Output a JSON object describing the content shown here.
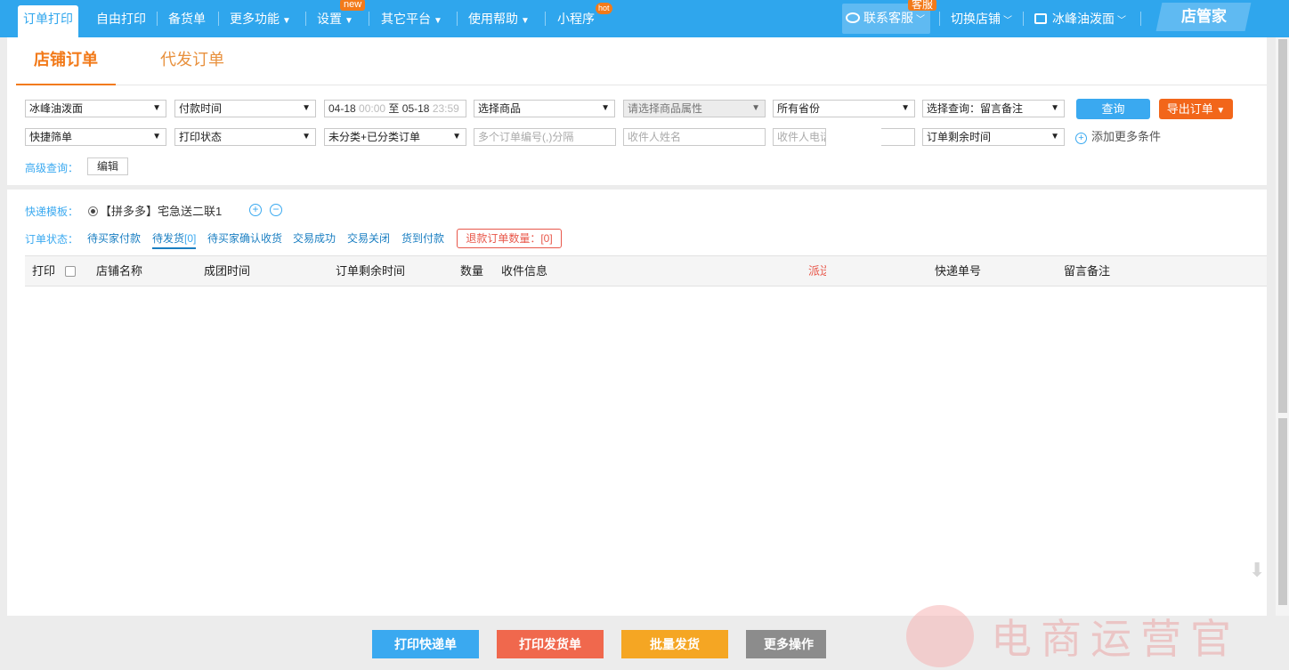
{
  "topnav": {
    "items": [
      {
        "label": "订单打印"
      },
      {
        "label": "自由打印"
      },
      {
        "label": "备货单"
      },
      {
        "label": "更多功能"
      },
      {
        "label": "设置",
        "badge": "new"
      },
      {
        "label": "其它平台"
      },
      {
        "label": "使用帮助"
      },
      {
        "label": "小程序",
        "badge": "hot"
      }
    ],
    "right": {
      "service": "联系客服",
      "service_badge": "客服",
      "switch_shop": "切换店铺",
      "shop_name": "冰峰油泼面",
      "brand": "店管家"
    }
  },
  "tabs": {
    "shop_orders": "店铺订单",
    "dropship_orders": "代发订单"
  },
  "filters": {
    "shop": "冰峰油泼面",
    "time_type": "付款时间",
    "date_from": "04-18",
    "time_from": "00:00",
    "date_sep": "至",
    "date_to": "05-18",
    "time_to": "23:59",
    "product": "选择商品",
    "product_attr": "请选择商品属性",
    "province": "所有省份",
    "query_select": "选择查询：留言备注",
    "quick_filter": "快捷筛单",
    "print_status": "打印状态",
    "category": "未分类+已分类订单",
    "order_no_placeholder": "多个订单编号(,)分隔",
    "receiver_name_placeholder": "收件人姓名",
    "receiver_phone_placeholder": "收件人电话",
    "remaining_time": "订单剩余时间",
    "query_button": "查询",
    "export_button": "导出订单",
    "add_more": "添加更多条件",
    "advanced_label": "高级查询：",
    "advanced_edit": "编辑"
  },
  "template": {
    "label": "快递模板：",
    "name": "【拼多多】宅急送二联1"
  },
  "status": {
    "label": "订单状态：",
    "items": [
      "待买家付款",
      "待发货",
      "待买家确认收货",
      "交易成功",
      "交易关闭",
      "货到付款"
    ],
    "pending_ship_count": "[0]",
    "refund_label": "退款订单数量：",
    "refund_count": "[0]"
  },
  "table": {
    "headers": [
      "打印",
      "店铺名称",
      "成团时间",
      "订单剩余时间",
      "数量",
      "收件信息",
      "派送",
      "快递单号",
      "留言备注"
    ]
  },
  "bottom": {
    "print_express": "打印快递单",
    "print_delivery": "打印发货单",
    "batch_ship": "批量发货",
    "more_ops": "更多操作"
  },
  "watermark": {
    "text": "电商运营官"
  },
  "colors": {
    "primary": "#2fa6ed",
    "accent": "#f27a1a",
    "danger": "#e8574a"
  }
}
